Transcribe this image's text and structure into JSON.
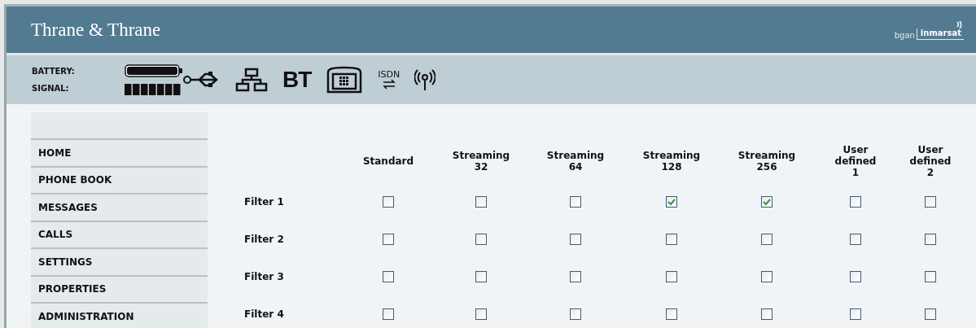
{
  "header": {
    "brand": "Thrane & Thrane",
    "partner_logo": {
      "left": "bgan",
      "right": "inmarsat"
    }
  },
  "status": {
    "labels": [
      "BATTERY:",
      "SIGNAL:"
    ],
    "icons": [
      {
        "kind": "usb"
      },
      {
        "kind": "network"
      },
      {
        "kind": "bluetooth",
        "label": "BT"
      },
      {
        "kind": "phone"
      },
      {
        "kind": "isdn",
        "label": "ISDN"
      },
      {
        "kind": "antenna"
      }
    ]
  },
  "sidebar": {
    "items": [
      {
        "label": "HOME"
      },
      {
        "label": "PHONE BOOK"
      },
      {
        "label": "MESSAGES"
      },
      {
        "label": "CALLS"
      },
      {
        "label": "SETTINGS"
      },
      {
        "label": "PROPERTIES"
      },
      {
        "label": "ADMINISTRATION"
      }
    ]
  },
  "table": {
    "columns": [
      "Standard",
      "Streaming\n32",
      "Streaming\n64",
      "Streaming\n128",
      "Streaming\n256",
      "User\ndefined\n1",
      "User\ndefined\n2"
    ],
    "rows": [
      {
        "label": "Filter 1",
        "checked": [
          false,
          false,
          false,
          true,
          true,
          false,
          false
        ]
      },
      {
        "label": "Filter 2",
        "checked": [
          false,
          false,
          false,
          false,
          false,
          false,
          false
        ]
      },
      {
        "label": "Filter 3",
        "checked": [
          false,
          false,
          false,
          false,
          false,
          false,
          false
        ]
      },
      {
        "label": "Filter 4",
        "checked": [
          false,
          false,
          false,
          false,
          false,
          false,
          false
        ]
      }
    ]
  }
}
